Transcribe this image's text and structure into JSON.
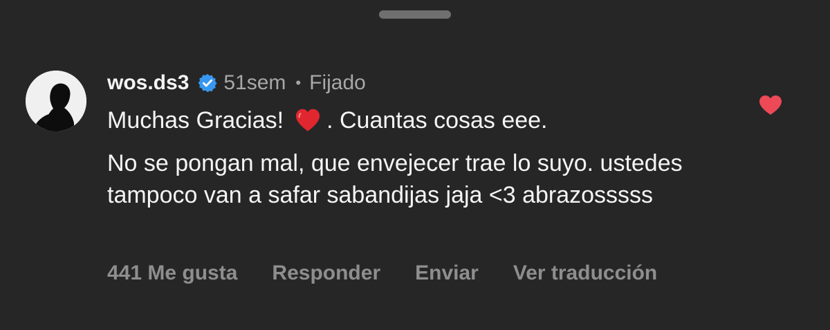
{
  "comment": {
    "username": "wos.ds3",
    "verified_icon": "verified-badge-icon",
    "time": "51sem",
    "separator": "•",
    "pinned": "Fijado",
    "text_line1_before": "Muchas Gracias!",
    "text_line1_emoji": "heart-emoji-icon",
    "text_line1_after": ". Cuantas cosas eee.",
    "text_body": "No se pongan mal, que envejecer trae lo suyo. ustedes tampoco van a safar sabandijas jaja <3 abrazosssss"
  },
  "actions": {
    "likes": "441 Me gusta",
    "reply": "Responder",
    "send": "Enviar",
    "translate": "Ver traducción"
  },
  "colors": {
    "background": "#262626",
    "primary_text": "#f5f5f5",
    "secondary_text": "#a8a8a8",
    "action_text": "#8e8e8e",
    "verified_blue": "#3897f0",
    "like_red": "#ed4956"
  },
  "icons": {
    "like": "heart-filled-icon",
    "avatar": "avatar-silhouette"
  }
}
